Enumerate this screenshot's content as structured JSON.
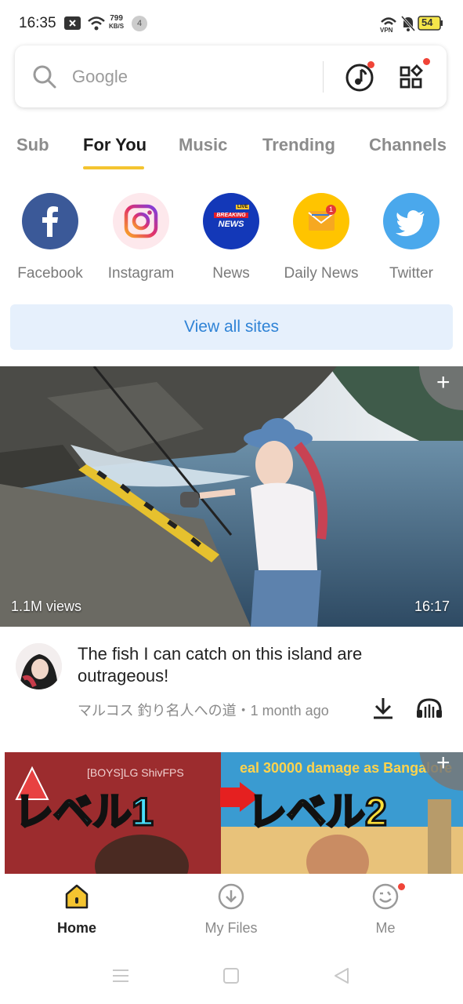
{
  "status_bar": {
    "time": "16:35",
    "speed_value": "799",
    "speed_unit": "KB/S",
    "notif_count": "4",
    "vpn_label": "VPN",
    "battery": "54"
  },
  "search": {
    "placeholder": "Google",
    "icons": [
      "search-icon",
      "music-note-icon",
      "apps-grid-icon"
    ]
  },
  "tabs": [
    {
      "label": "Sub"
    },
    {
      "label": "For You",
      "active": true
    },
    {
      "label": "Music"
    },
    {
      "label": "Trending"
    },
    {
      "label": "Channels"
    }
  ],
  "sites": [
    {
      "label": "Facebook",
      "icon": "facebook-icon",
      "color": "#3b5998"
    },
    {
      "label": "Instagram",
      "icon": "instagram-icon",
      "color": "#fde8ec"
    },
    {
      "label": "News",
      "icon": "breaking-news-icon",
      "color": "#1338b8",
      "badge_top": "LIVE",
      "badge_mid": "BREAKING",
      "badge_bottom": "NEWS"
    },
    {
      "label": "Daily News",
      "icon": "mail-news-icon",
      "color": "#ffc400",
      "count": "1"
    },
    {
      "label": "Twitter",
      "icon": "twitter-icon",
      "color": "#4aa8ec"
    }
  ],
  "view_all": "View all sites",
  "videos": [
    {
      "views": "1.1M views",
      "duration": "16:17",
      "title": "The fish I can catch on this island are outrageous!",
      "channel_meta": "マルコス 釣り名人への道・1 month ago"
    },
    {
      "thumb_text_left": "レベル1",
      "thumb_text_right": "レベル2",
      "thumb_small": "[BOYS]LG ShivFPS",
      "thumb_banner": "eal 30000 damage as Bangalore"
    }
  ],
  "bottom_nav": [
    {
      "label": "Home",
      "icon": "home-icon",
      "active": true
    },
    {
      "label": "My Files",
      "icon": "download-circle-icon"
    },
    {
      "label": "Me",
      "icon": "smiley-icon"
    }
  ],
  "colors": {
    "accent": "#f4c430",
    "link": "#2f83d6",
    "red_dot": "#f04438"
  }
}
